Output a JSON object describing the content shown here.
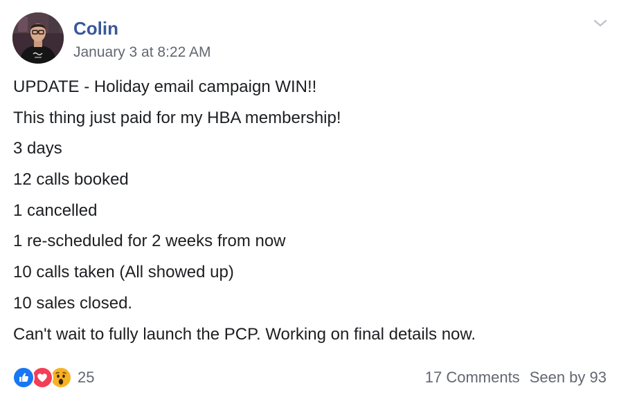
{
  "post": {
    "author": "Colin",
    "timestamp": "January 3 at 8:22 AM",
    "lines": [
      "UPDATE - Holiday email campaign WIN!!",
      "This thing just paid for my HBA membership!",
      "3 days",
      "12 calls booked",
      "1 cancelled",
      "1 re-scheduled for 2 weeks from now",
      "10 calls taken (All showed up)",
      "10 sales closed.",
      "Can't wait to fully launch the PCP. Working on final details now."
    ]
  },
  "footer": {
    "reactions": [
      "like-icon",
      "love-icon",
      "wow-icon"
    ],
    "reaction_count": "25",
    "comments": "17 Comments",
    "seen_by": "Seen by 93"
  },
  "colors": {
    "author": "#385898",
    "meta": "#616770",
    "text": "#1c1e21",
    "like": "#1877f2",
    "love": "#f33e58",
    "wow": "#f7b125"
  }
}
